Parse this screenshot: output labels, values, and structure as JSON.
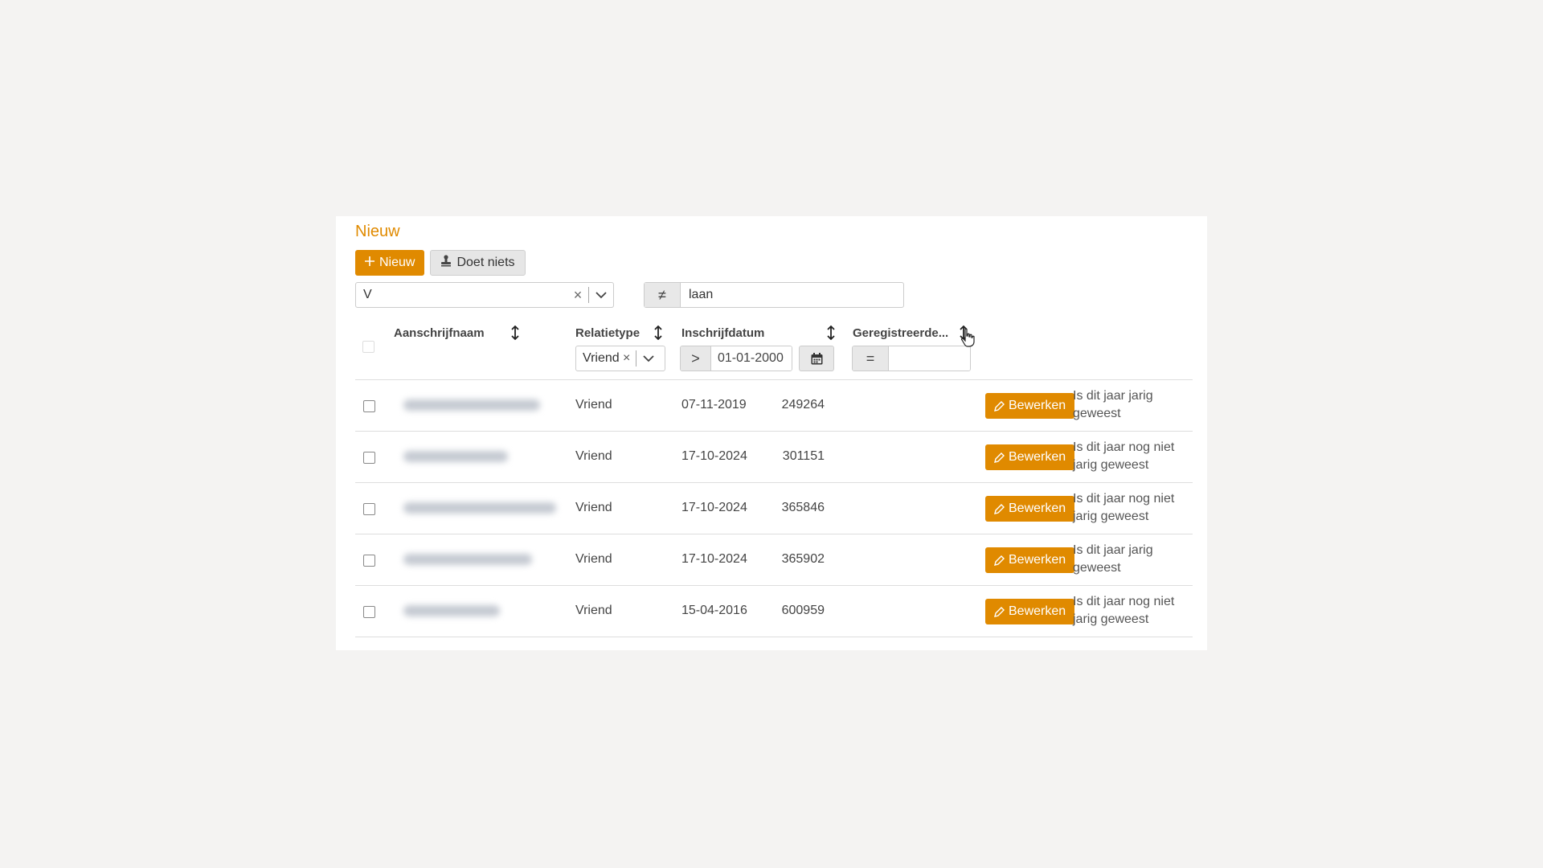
{
  "section_title": "Nieuw",
  "toolbar": {
    "new_label": "Nieuw",
    "noop_label": "Doet niets"
  },
  "filter_bar": {
    "combo_value": "V",
    "text_operator": "≠",
    "text_value": "laan"
  },
  "columns": {
    "name": "Aanschrijfnaam",
    "relation": "Relatietype",
    "date": "Inschrijfdatum",
    "registered": "Geregistreerde..."
  },
  "column_filters": {
    "relation_value": "Vriend",
    "date_operator": ">",
    "date_value": "01-01-2000",
    "number_operator": "="
  },
  "edit_label": "Bewerken",
  "rows": [
    {
      "relation": "Vriend",
      "date": "07-11-2019",
      "number": "249264",
      "note_line1": "Is dit jaar jarig",
      "note_line2": "geweest"
    },
    {
      "relation": "Vriend",
      "date": "17-10-2024",
      "number": "301151",
      "note_line1": "Is dit jaar nog niet",
      "note_line2": "jarig geweest"
    },
    {
      "relation": "Vriend",
      "date": "17-10-2024",
      "number": "365846",
      "note_line1": "Is dit jaar nog niet",
      "note_line2": "jarig geweest"
    },
    {
      "relation": "Vriend",
      "date": "17-10-2024",
      "number": "365902",
      "note_line1": "Is dit jaar jarig",
      "note_line2": "geweest"
    },
    {
      "relation": "Vriend",
      "date": "15-04-2016",
      "number": "600959",
      "note_line1": "Is dit jaar nog niet",
      "note_line2": "jarig geweest"
    }
  ],
  "colors": {
    "accent": "#e08a00",
    "background": "#f4f3f2",
    "card": "#ffffff"
  }
}
